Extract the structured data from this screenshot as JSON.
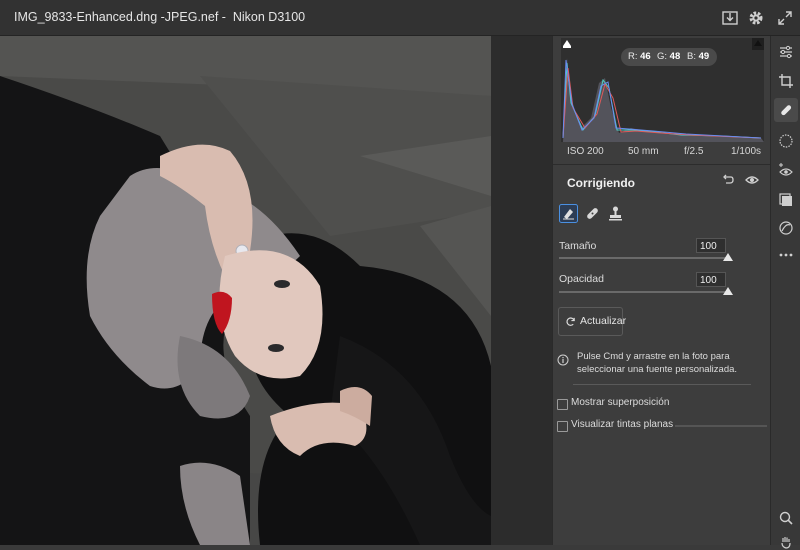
{
  "window": {
    "title": "IMG_9833-Enhanced.dng -JPEG.nef -  Nikon D3100"
  },
  "titlebar_icons": [
    "download-icon",
    "gear-icon",
    "expand-icon"
  ],
  "histogram": {
    "r_label": "R:",
    "r_value": "46",
    "g_label": "G:",
    "g_value": "48",
    "b_label": "B:",
    "b_value": "49"
  },
  "exif": {
    "iso": "ISO 200",
    "focal": "50 mm",
    "aperture": "f/2.5",
    "shutter": "1/100s"
  },
  "panel": {
    "title": "Corrigiendo",
    "tools": [
      "brush-icon",
      "bandage-icon",
      "stamp-icon"
    ],
    "size_label": "Tamaño",
    "size_value": "100",
    "size_level": 1.0,
    "opacity_label": "Opacidad",
    "opacity_value": "100",
    "opacity_level": 1.0,
    "refresh_label": "Actualizar",
    "info_text": "Pulse Cmd y arrastre en la foto para seleccionar una fuente personalizada.",
    "overlay_label": "Mostrar superposición",
    "overlay_checked": false,
    "flat_tint_label": "Visualizar tintas planas",
    "flat_tint_checked": false
  },
  "tool_rail": [
    "sliders-icon",
    "crop-icon",
    "healing-icon",
    "mask-icon",
    "red-eye-icon",
    "presets-icon",
    "snapshot-icon",
    "more-icon",
    "zoom-icon",
    "hand-icon"
  ],
  "colors": {
    "accent": "#4a90e2",
    "panel_bg": "#3d3d3d"
  }
}
